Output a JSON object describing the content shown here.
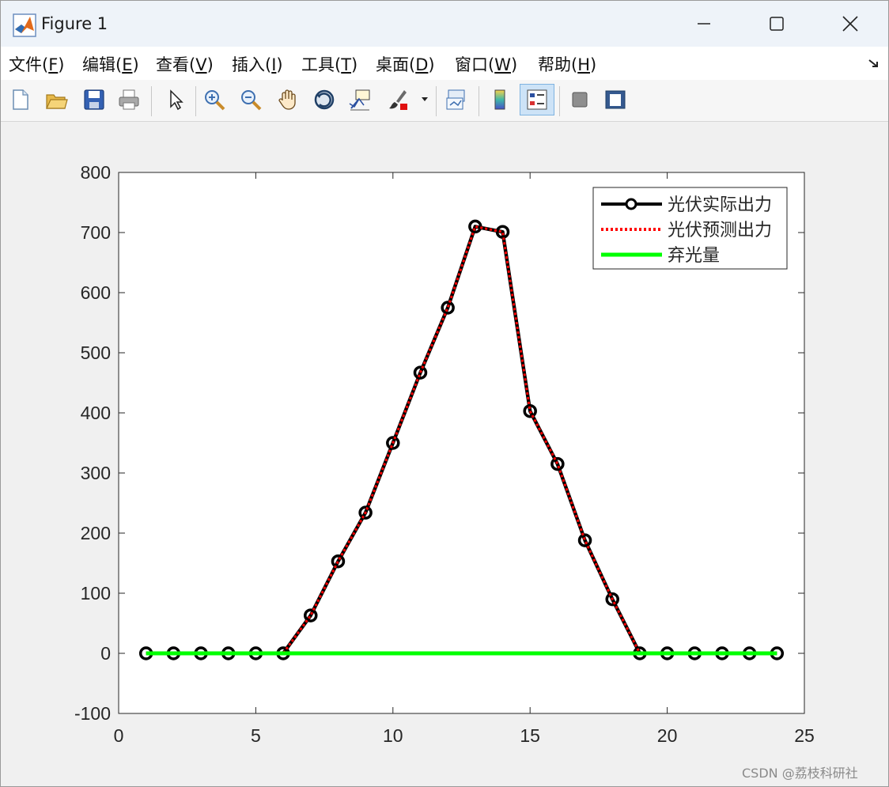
{
  "window": {
    "title": "Figure 1",
    "app_icon": "matlab-logo-icon",
    "controls": [
      "minimize-icon",
      "maximize-icon",
      "close-icon"
    ]
  },
  "menu": [
    {
      "label": "文件(",
      "key": "F",
      "suffix": ")"
    },
    {
      "label": "编辑(",
      "key": "E",
      "suffix": ")"
    },
    {
      "label": "查看(",
      "key": "V",
      "suffix": ")"
    },
    {
      "label": "插入(",
      "key": "I",
      "suffix": ")"
    },
    {
      "label": "工具(",
      "key": "T",
      "suffix": ")"
    },
    {
      "label": "桌面(",
      "key": "D",
      "suffix": ")"
    },
    {
      "label": "窗口(",
      "key": "W",
      "suffix": ")"
    },
    {
      "label": "帮助(",
      "key": "H",
      "suffix": ")"
    }
  ],
  "toolbar": [
    "new-figure-icon",
    "open-file-icon",
    "save-icon",
    "print-icon",
    "pointer-icon",
    "zoom-in-icon",
    "zoom-out-icon",
    "pan-hand-icon",
    "rotate-3d-icon",
    "data-cursor-icon",
    "brush-icon",
    "brush-dropdown-icon",
    "link-plot-icon",
    "colorbar-icon",
    "legend-icon",
    "hide-plot-tools-icon",
    "show-plot-tools-icon"
  ],
  "chart_data": {
    "type": "line",
    "x": [
      1,
      2,
      3,
      4,
      5,
      6,
      7,
      8,
      9,
      10,
      11,
      12,
      13,
      14,
      15,
      16,
      17,
      18,
      19,
      20,
      21,
      22,
      23,
      24
    ],
    "xlim": [
      0,
      25
    ],
    "ylim": [
      -100,
      800
    ],
    "xticks": [
      0,
      5,
      10,
      15,
      20,
      25
    ],
    "yticks": [
      -100,
      0,
      100,
      200,
      300,
      400,
      500,
      600,
      700,
      800
    ],
    "grid": false,
    "legend_position": "top-right",
    "series": [
      {
        "name": "光伏实际出力",
        "color": "#000000",
        "style": "solid-circle-markers",
        "values": [
          0,
          0,
          0,
          0,
          0,
          0,
          63,
          153,
          234,
          350,
          467,
          575,
          710,
          701,
          403,
          315,
          188,
          90,
          0,
          0,
          0,
          0,
          0,
          0
        ]
      },
      {
        "name": "光伏预测出力",
        "color": "#ff0000",
        "style": "dotted",
        "values": [
          0,
          0,
          0,
          0,
          0,
          0,
          63,
          153,
          234,
          350,
          467,
          575,
          710,
          701,
          403,
          315,
          188,
          90,
          0,
          0,
          0,
          0,
          0,
          0
        ]
      },
      {
        "name": "弃光量",
        "color": "#00ff00",
        "style": "solid",
        "values": [
          0,
          0,
          0,
          0,
          0,
          0,
          0,
          0,
          0,
          0,
          0,
          0,
          0,
          0,
          0,
          0,
          0,
          0,
          0,
          0,
          0,
          0,
          0,
          0
        ]
      }
    ]
  },
  "watermark": "CSDN @荔枝科研社"
}
